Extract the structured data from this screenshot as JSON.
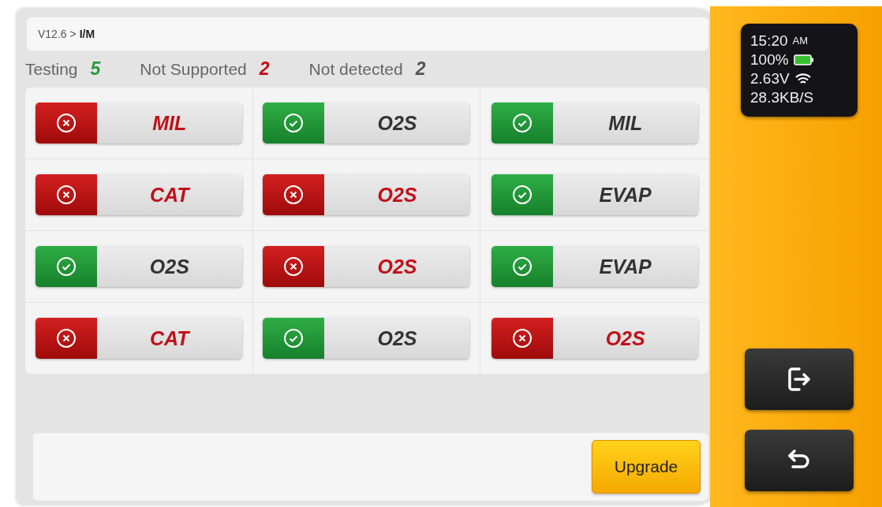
{
  "breadcrumb": {
    "path": "V12.6 >",
    "current": "I/M"
  },
  "summary": [
    {
      "label": "Testing",
      "count": "5",
      "kind": "pass"
    },
    {
      "label": "Not Supported",
      "count": "2",
      "kind": "fail"
    },
    {
      "label": "Not detected",
      "count": "2",
      "kind": "neutral"
    }
  ],
  "monitors": [
    {
      "label": "MIL",
      "kind": "fail"
    },
    {
      "label": "O2S",
      "kind": "pass"
    },
    {
      "label": "MIL",
      "kind": "pass"
    },
    {
      "label": "CAT",
      "kind": "fail"
    },
    {
      "label": "O2S",
      "kind": "fail"
    },
    {
      "label": "EVAP",
      "kind": "pass"
    },
    {
      "label": "O2S",
      "kind": "pass"
    },
    {
      "label": "O2S",
      "kind": "fail"
    },
    {
      "label": "EVAP",
      "kind": "pass"
    },
    {
      "label": "CAT",
      "kind": "fail"
    },
    {
      "label": "O2S",
      "kind": "pass"
    },
    {
      "label": "O2S",
      "kind": "fail"
    }
  ],
  "upgrade_button": "Upgrade",
  "status_card": {
    "time": "15:20",
    "meridiem": "AM",
    "battery": "100%",
    "voltage": "2.63V",
    "speed": "28.3KB/S"
  }
}
